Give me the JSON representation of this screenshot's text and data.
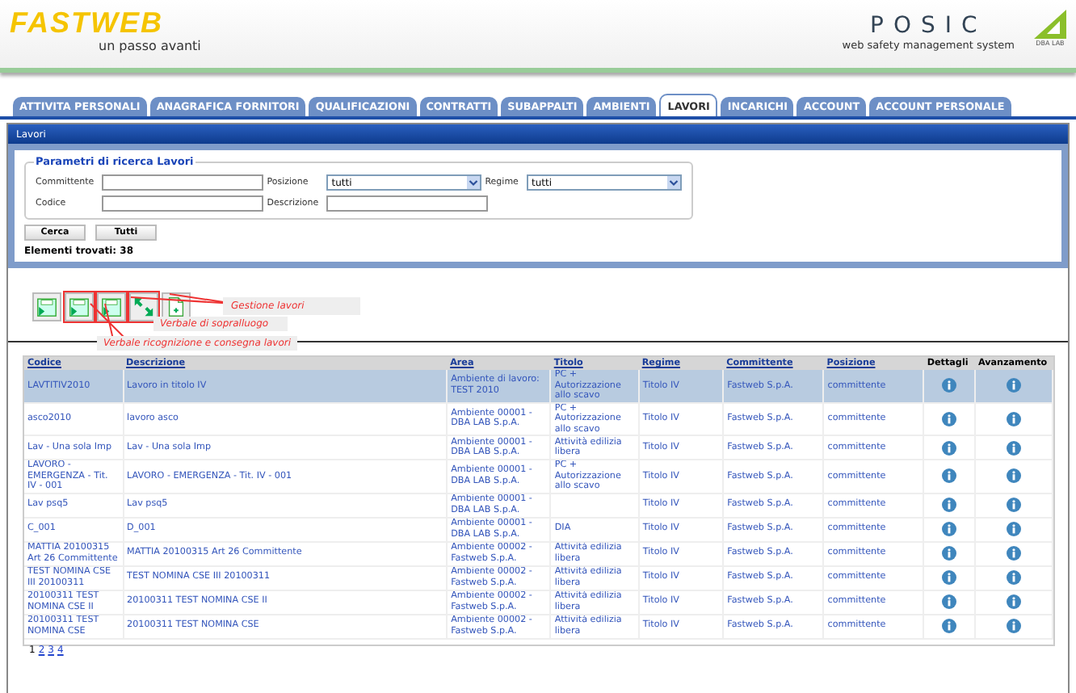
{
  "header": {
    "brand": "FASTWEB",
    "slogan": "un passo avanti",
    "product": "POSIC",
    "product_subtitle": "web safety management system",
    "partner": "DBA LAB"
  },
  "tabs": [
    {
      "label": "ATTIVITA PERSONALI",
      "selected": false
    },
    {
      "label": "ANAGRAFICA FORNITORI",
      "selected": false
    },
    {
      "label": "QUALIFICAZIONI",
      "selected": false
    },
    {
      "label": "CONTRATTI",
      "selected": false
    },
    {
      "label": "SUBAPPALTI",
      "selected": false
    },
    {
      "label": "AMBIENTI",
      "selected": false
    },
    {
      "label": "LAVORI",
      "selected": true
    },
    {
      "label": "INCARICHI",
      "selected": false
    },
    {
      "label": "ACCOUNT",
      "selected": false
    },
    {
      "label": "ACCOUNT PERSONALE",
      "selected": false
    }
  ],
  "panel_title": "Lavori",
  "search": {
    "legend": "Parametri di ricerca Lavori",
    "fields": [
      {
        "kind": "text",
        "label": "Committente"
      },
      {
        "kind": "select",
        "label": "Posizione",
        "value": "tutti"
      },
      {
        "kind": "select",
        "label": "Regime",
        "value": "tutti"
      },
      {
        "kind": "text",
        "label": "Codice"
      },
      {
        "kind": "text",
        "label": "Descrizione"
      }
    ],
    "buttons": [
      "Cerca",
      "Tutti"
    ],
    "result_count": "Elementi trovati: 38"
  },
  "toolbar": {
    "tooltips": [
      "Gestione lavori",
      "Verbale di sopralluogo",
      "Verbale ricognizione e consegna lavori"
    ]
  },
  "table": {
    "columns": [
      "Codice",
      "Descrizione",
      "Area",
      "Titolo",
      "Regime",
      "Committente",
      "Posizione",
      "Dettagli",
      "Avanzamento"
    ],
    "rows": [
      {
        "selected": true,
        "cells": [
          "LAVTITIV2010",
          "Lavoro in titolo IV",
          "Ambiente di lavoro: TEST 2010",
          "PC + Autorizzazione allo scavo",
          "Titolo IV",
          "Fastweb S.p.A.",
          "committente"
        ]
      },
      {
        "selected": false,
        "cells": [
          "asco2010",
          "lavoro asco",
          "Ambiente 00001 - DBA LAB S.p.A.",
          "PC + Autorizzazione allo scavo",
          "Titolo IV",
          "Fastweb S.p.A.",
          "committente"
        ]
      },
      {
        "selected": false,
        "cells": [
          "Lav - Una sola Imp",
          "Lav - Una sola Imp",
          "Ambiente 00001 - DBA LAB S.p.A.",
          "Attività edilizia libera",
          "Titolo IV",
          "Fastweb S.p.A.",
          "committente"
        ]
      },
      {
        "selected": false,
        "cells": [
          "LAVORO - EMERGENZA - Tit. IV - 001",
          "LAVORO - EMERGENZA - Tit. IV - 001",
          "Ambiente 00001 - DBA LAB S.p.A.",
          "PC + Autorizzazione allo scavo",
          "Titolo IV",
          "Fastweb S.p.A.",
          "committente"
        ]
      },
      {
        "selected": false,
        "cells": [
          "Lav psq5",
          "Lav psq5",
          "Ambiente 00001 - DBA LAB S.p.A.",
          "",
          "Titolo IV",
          "Fastweb S.p.A.",
          "committente"
        ]
      },
      {
        "selected": false,
        "cells": [
          "C_001",
          "D_001",
          "Ambiente 00001 - DBA LAB S.p.A.",
          "DIA",
          "Titolo IV",
          "Fastweb S.p.A.",
          "committente"
        ]
      },
      {
        "selected": false,
        "cells": [
          "MATTIA 20100315 Art 26 Committente",
          "MATTIA 20100315 Art 26 Committente",
          "Ambiente 00002 - Fastweb S.p.A.",
          "Attività edilizia libera",
          "Titolo IV",
          "Fastweb S.p.A.",
          "committente"
        ]
      },
      {
        "selected": false,
        "cells": [
          "TEST NOMINA CSE III 20100311",
          "TEST NOMINA CSE III 20100311",
          "Ambiente 00002 - Fastweb S.p.A.",
          "Attività edilizia libera",
          "Titolo IV",
          "Fastweb S.p.A.",
          "committente"
        ]
      },
      {
        "selected": false,
        "cells": [
          "20100311 TEST NOMINA CSE II",
          "20100311 TEST NOMINA CSE II",
          "Ambiente 00002 - Fastweb S.p.A.",
          "Attività edilizia libera",
          "Titolo IV",
          "Fastweb S.p.A.",
          "committente"
        ]
      },
      {
        "selected": false,
        "cells": [
          "20100311 TEST NOMINA CSE",
          "20100311 TEST NOMINA CSE",
          "Ambiente 00002 - Fastweb S.p.A.",
          "Attività edilizia libera",
          "Titolo IV",
          "Fastweb S.p.A.",
          "committente"
        ]
      }
    ]
  },
  "pagination": [
    {
      "label": "1",
      "selected": true
    },
    {
      "label": "2",
      "selected": false
    },
    {
      "label": "3",
      "selected": false
    },
    {
      "label": "4",
      "selected": false
    }
  ]
}
